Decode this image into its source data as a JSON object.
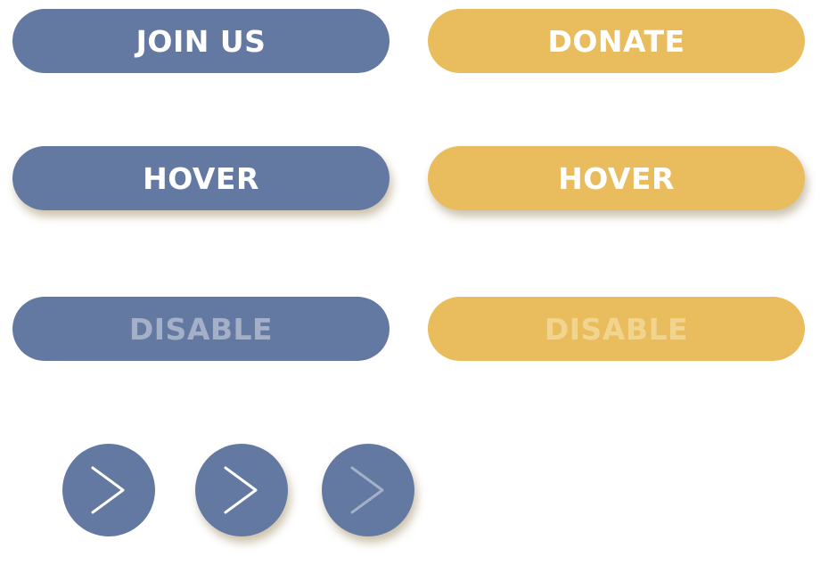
{
  "buttons": {
    "join": {
      "label": "JOIN US",
      "state": "default"
    },
    "donate": {
      "label": "DONATE",
      "state": "default"
    },
    "join_hover": {
      "label": "HOVER",
      "state": "hover"
    },
    "donate_hover": {
      "label": "HOVER",
      "state": "hover"
    },
    "join_disabled": {
      "label": "DISABLE",
      "state": "disabled"
    },
    "donate_disabled": {
      "label": "DISABLE",
      "state": "disabled"
    }
  },
  "arrow_buttons": [
    {
      "icon": "chevron-right-icon",
      "state": "default"
    },
    {
      "icon": "chevron-right-icon",
      "state": "hover"
    },
    {
      "icon": "chevron-right-icon",
      "state": "disabled"
    }
  ],
  "colors": {
    "primary_blue": "#6479a1",
    "accent_gold": "#e9bc5d",
    "text": "#ffffff",
    "disabled_text_blue": "#a3b0c8",
    "disabled_text_gold": "#f1d58e"
  }
}
